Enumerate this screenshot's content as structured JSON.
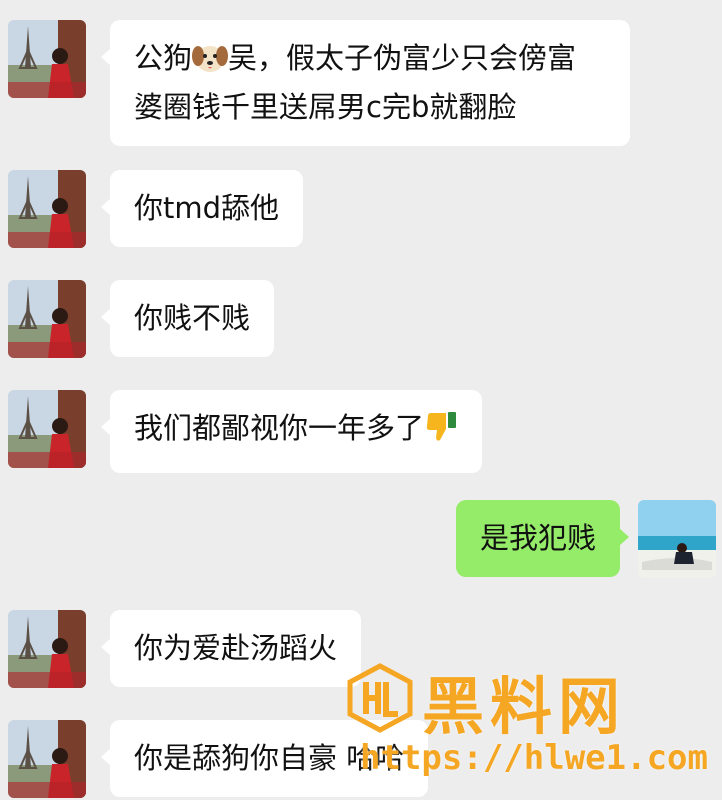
{
  "chat": {
    "messages": [
      {
        "sender": "other",
        "avatar": "eiffel-avatar",
        "lines": [
          "公狗",
          "吴，假太子伪富少只会傍富",
          "婆圈钱千里送屌男c完b就翻脸"
        ],
        "emoji": "dog-face"
      },
      {
        "sender": "other",
        "avatar": "eiffel-avatar",
        "text": "你tmd舔他"
      },
      {
        "sender": "other",
        "avatar": "eiffel-avatar",
        "text": "你贱不贱"
      },
      {
        "sender": "other",
        "avatar": "eiffel-avatar",
        "text": "我们都鄙视你一年多了",
        "emoji": "thumbs-down"
      },
      {
        "sender": "me",
        "avatar": "beach-avatar",
        "text": "是我犯贱"
      },
      {
        "sender": "other",
        "avatar": "eiffel-avatar",
        "text": "你为爱赴汤蹈火"
      },
      {
        "sender": "other",
        "avatar": "eiffel-avatar",
        "text": "你是舔狗你自豪 哈哈"
      }
    ]
  },
  "watermark": {
    "title": "黑料网",
    "url": "https://hlwe1.com",
    "color": "#f5a623"
  },
  "colors": {
    "background": "#ededed",
    "bubble_other": "#ffffff",
    "bubble_me": "#95ec69"
  }
}
